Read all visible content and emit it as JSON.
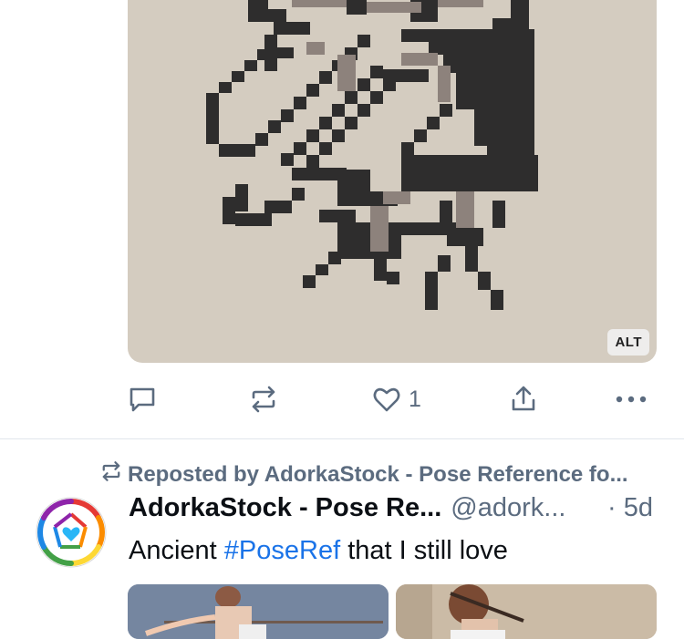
{
  "post1": {
    "alt_badge": "ALT",
    "like_count": "1"
  },
  "post2": {
    "repost_label": "Reposted by AdorkaStock - Pose Reference fo...",
    "author_name": "AdorkaStock - Pose Re...",
    "author_handle": "@adork...",
    "time": "· 5d",
    "text_before": "Ancient ",
    "hashtag": "#PoseRef",
    "text_after": " that I still love"
  },
  "icons": {
    "reply": "comment-icon",
    "repost": "repost-icon",
    "like": "heart-icon",
    "share": "share-icon",
    "more": "more-icon"
  },
  "colors": {
    "muted": "#5b6b7f",
    "hashtag": "#1a73e8",
    "image_bg": "#d4ccc0",
    "pixel_dark": "#2e2d2d",
    "pixel_mid": "#8d827c"
  }
}
